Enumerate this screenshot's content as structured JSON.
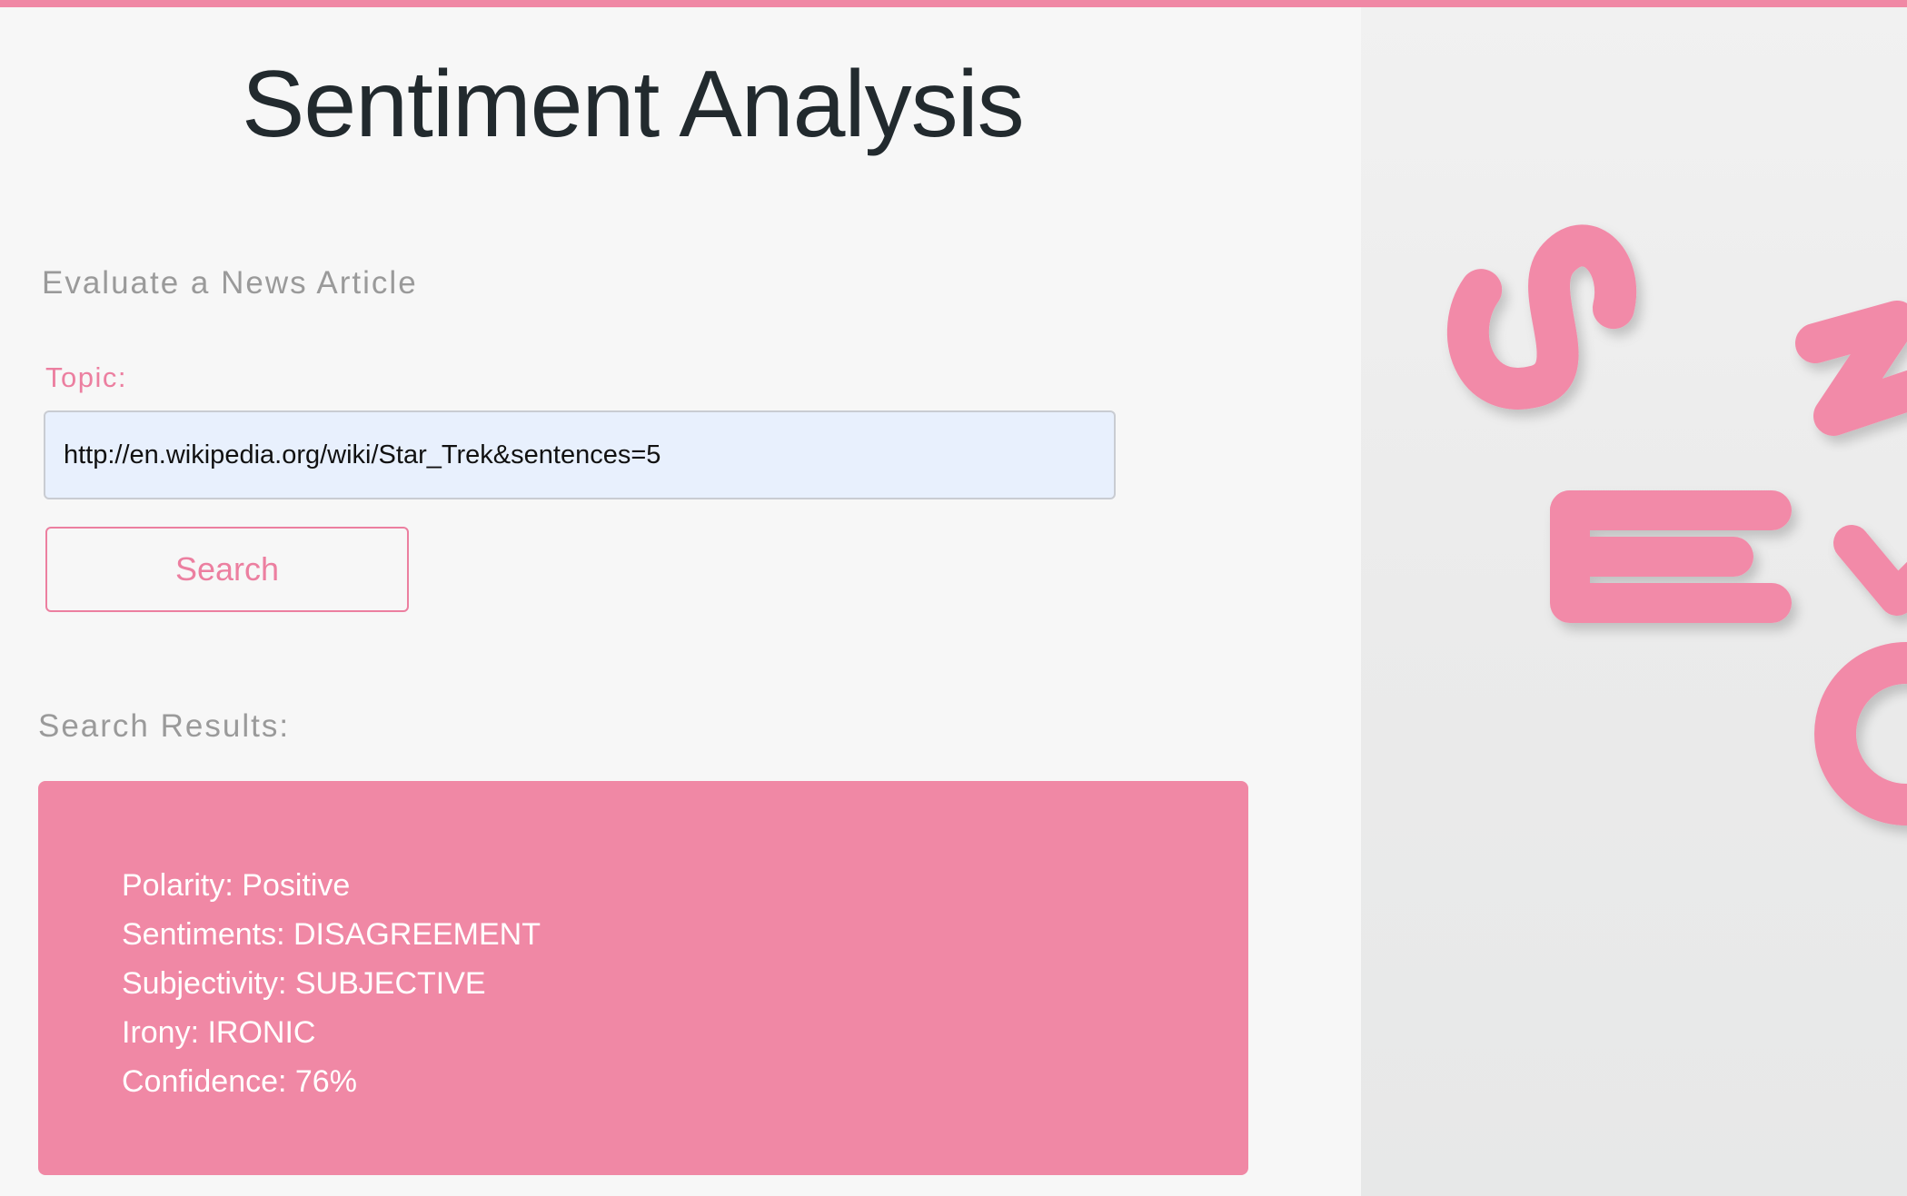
{
  "page": {
    "title": "Sentiment Analysis",
    "accent_color": "#f088a5",
    "label_color": "#ec7fa0"
  },
  "form": {
    "heading": "Evaluate a News Article",
    "topic_label": "Topic:",
    "topic_value": "http://en.wikipedia.org/wiki/Star_Trek&sentences=5",
    "search_label": "Search"
  },
  "results": {
    "heading": "Search Results:",
    "lines": [
      "Polarity: Positive",
      "Sentiments: DISAGREEMENT",
      "Subjectivity: SUBJECTIVE",
      "Irony: IRONIC",
      "Confidence: 76%"
    ]
  },
  "hero": {
    "icon": "pink-magnetic-letters-image",
    "color": "#f28aa8"
  }
}
